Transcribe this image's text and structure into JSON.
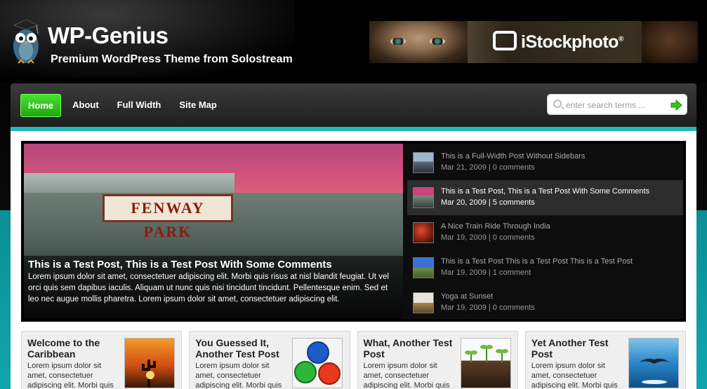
{
  "header": {
    "title": "WP-Genius",
    "tagline": "Premium WordPress Theme from Solostream",
    "banner_text": "iStockphoto",
    "banner_reg": "®"
  },
  "nav": {
    "items": [
      {
        "label": "Home",
        "active": true
      },
      {
        "label": "About"
      },
      {
        "label": "Full Width"
      },
      {
        "label": "Site Map"
      }
    ]
  },
  "search": {
    "placeholder": "enter search terms ...",
    "value": ""
  },
  "featured": {
    "sign": "FENWAY PARK",
    "title": "This is a Test Post, This is a Test Post With Some Comments",
    "excerpt": "Lorem ipsum dolor sit amet, consectetuer adipiscing elit. Morbi quis risus at nisl blandit feugiat. Ut vel orci quis sem dapibus iaculis. Aliquam ut nunc quis nisi tincidunt tincidunt. Pellentesque enim. Sed et leo nec augue mollis pharetra. Lorem ipsum dolor sit amet, consectetuer adipiscing elit."
  },
  "posts": [
    {
      "title": "This is a Full-Width Post Without Sidebars",
      "meta": "Mar 21, 2009 | 0 comments"
    },
    {
      "title": "This is a Test Post, This is a Test Post With Some Comments",
      "meta": "Mar 20, 2009 | 5 comments"
    },
    {
      "title": "A Nice Train Ride Through India",
      "meta": "Mar 19, 2009 | 0 comments"
    },
    {
      "title": "This is a Test Post This is a Test Post This is a Test Post",
      "meta": "Mar 19, 2009 | 1 comment"
    },
    {
      "title": "Yoga at Sunset",
      "meta": "Mar 19, 2009 | 0 comments"
    }
  ],
  "boxes": [
    {
      "title": "Welcome to the Caribbean",
      "text": "Lorem ipsum dolor sit amet, consectetuer adipiscing elit. Morbi quis risus at nisl"
    },
    {
      "title": "You Guessed It, Another Test Post",
      "text": "Lorem ipsum dolor sit amet, consectetuer adipiscing elit. Morbi quis risus at nisl"
    },
    {
      "title": "What, Another Test Post",
      "text": "Lorem ipsum dolor sit amet, consectetuer adipiscing elit. Morbi quis risus at nisl"
    },
    {
      "title": "Yet Another Test Post",
      "text": "Lorem ipsum dolor sit amet, consectetuer adipiscing elit. Morbi quis risus at nisl"
    }
  ],
  "colors": {
    "accent_green": "#2fc51b",
    "teal_stripe": "#22b7bb",
    "teal_background": "#10a5ad"
  }
}
